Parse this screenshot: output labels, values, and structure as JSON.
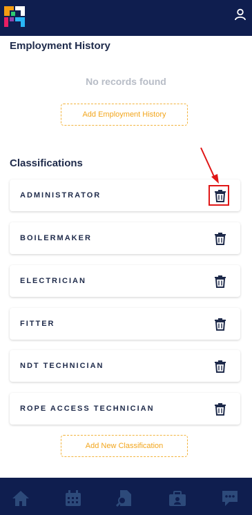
{
  "employment": {
    "title": "Employment History",
    "empty_text": "No records found",
    "add_label": "Add Employment History"
  },
  "classifications": {
    "title": "Classifications",
    "items": [
      {
        "label": "ADMINISTRATOR"
      },
      {
        "label": "BOILERMAKER"
      },
      {
        "label": "ELECTRICIAN"
      },
      {
        "label": "FITTER"
      },
      {
        "label": "NDT TECHNICIAN"
      },
      {
        "label": "ROPE ACCESS TECHNICIAN"
      }
    ],
    "add_label": "Add New Classification"
  },
  "icons": {
    "top_right": "user-icon",
    "row_action": "trash-icon",
    "nav": [
      "home-icon",
      "calendar-icon",
      "document-search-icon",
      "briefcase-user-icon",
      "chat-icon"
    ]
  },
  "colors": {
    "nav_bg": "#0f1e4f",
    "accent": "#f2a51b",
    "highlight": "#e01616"
  }
}
